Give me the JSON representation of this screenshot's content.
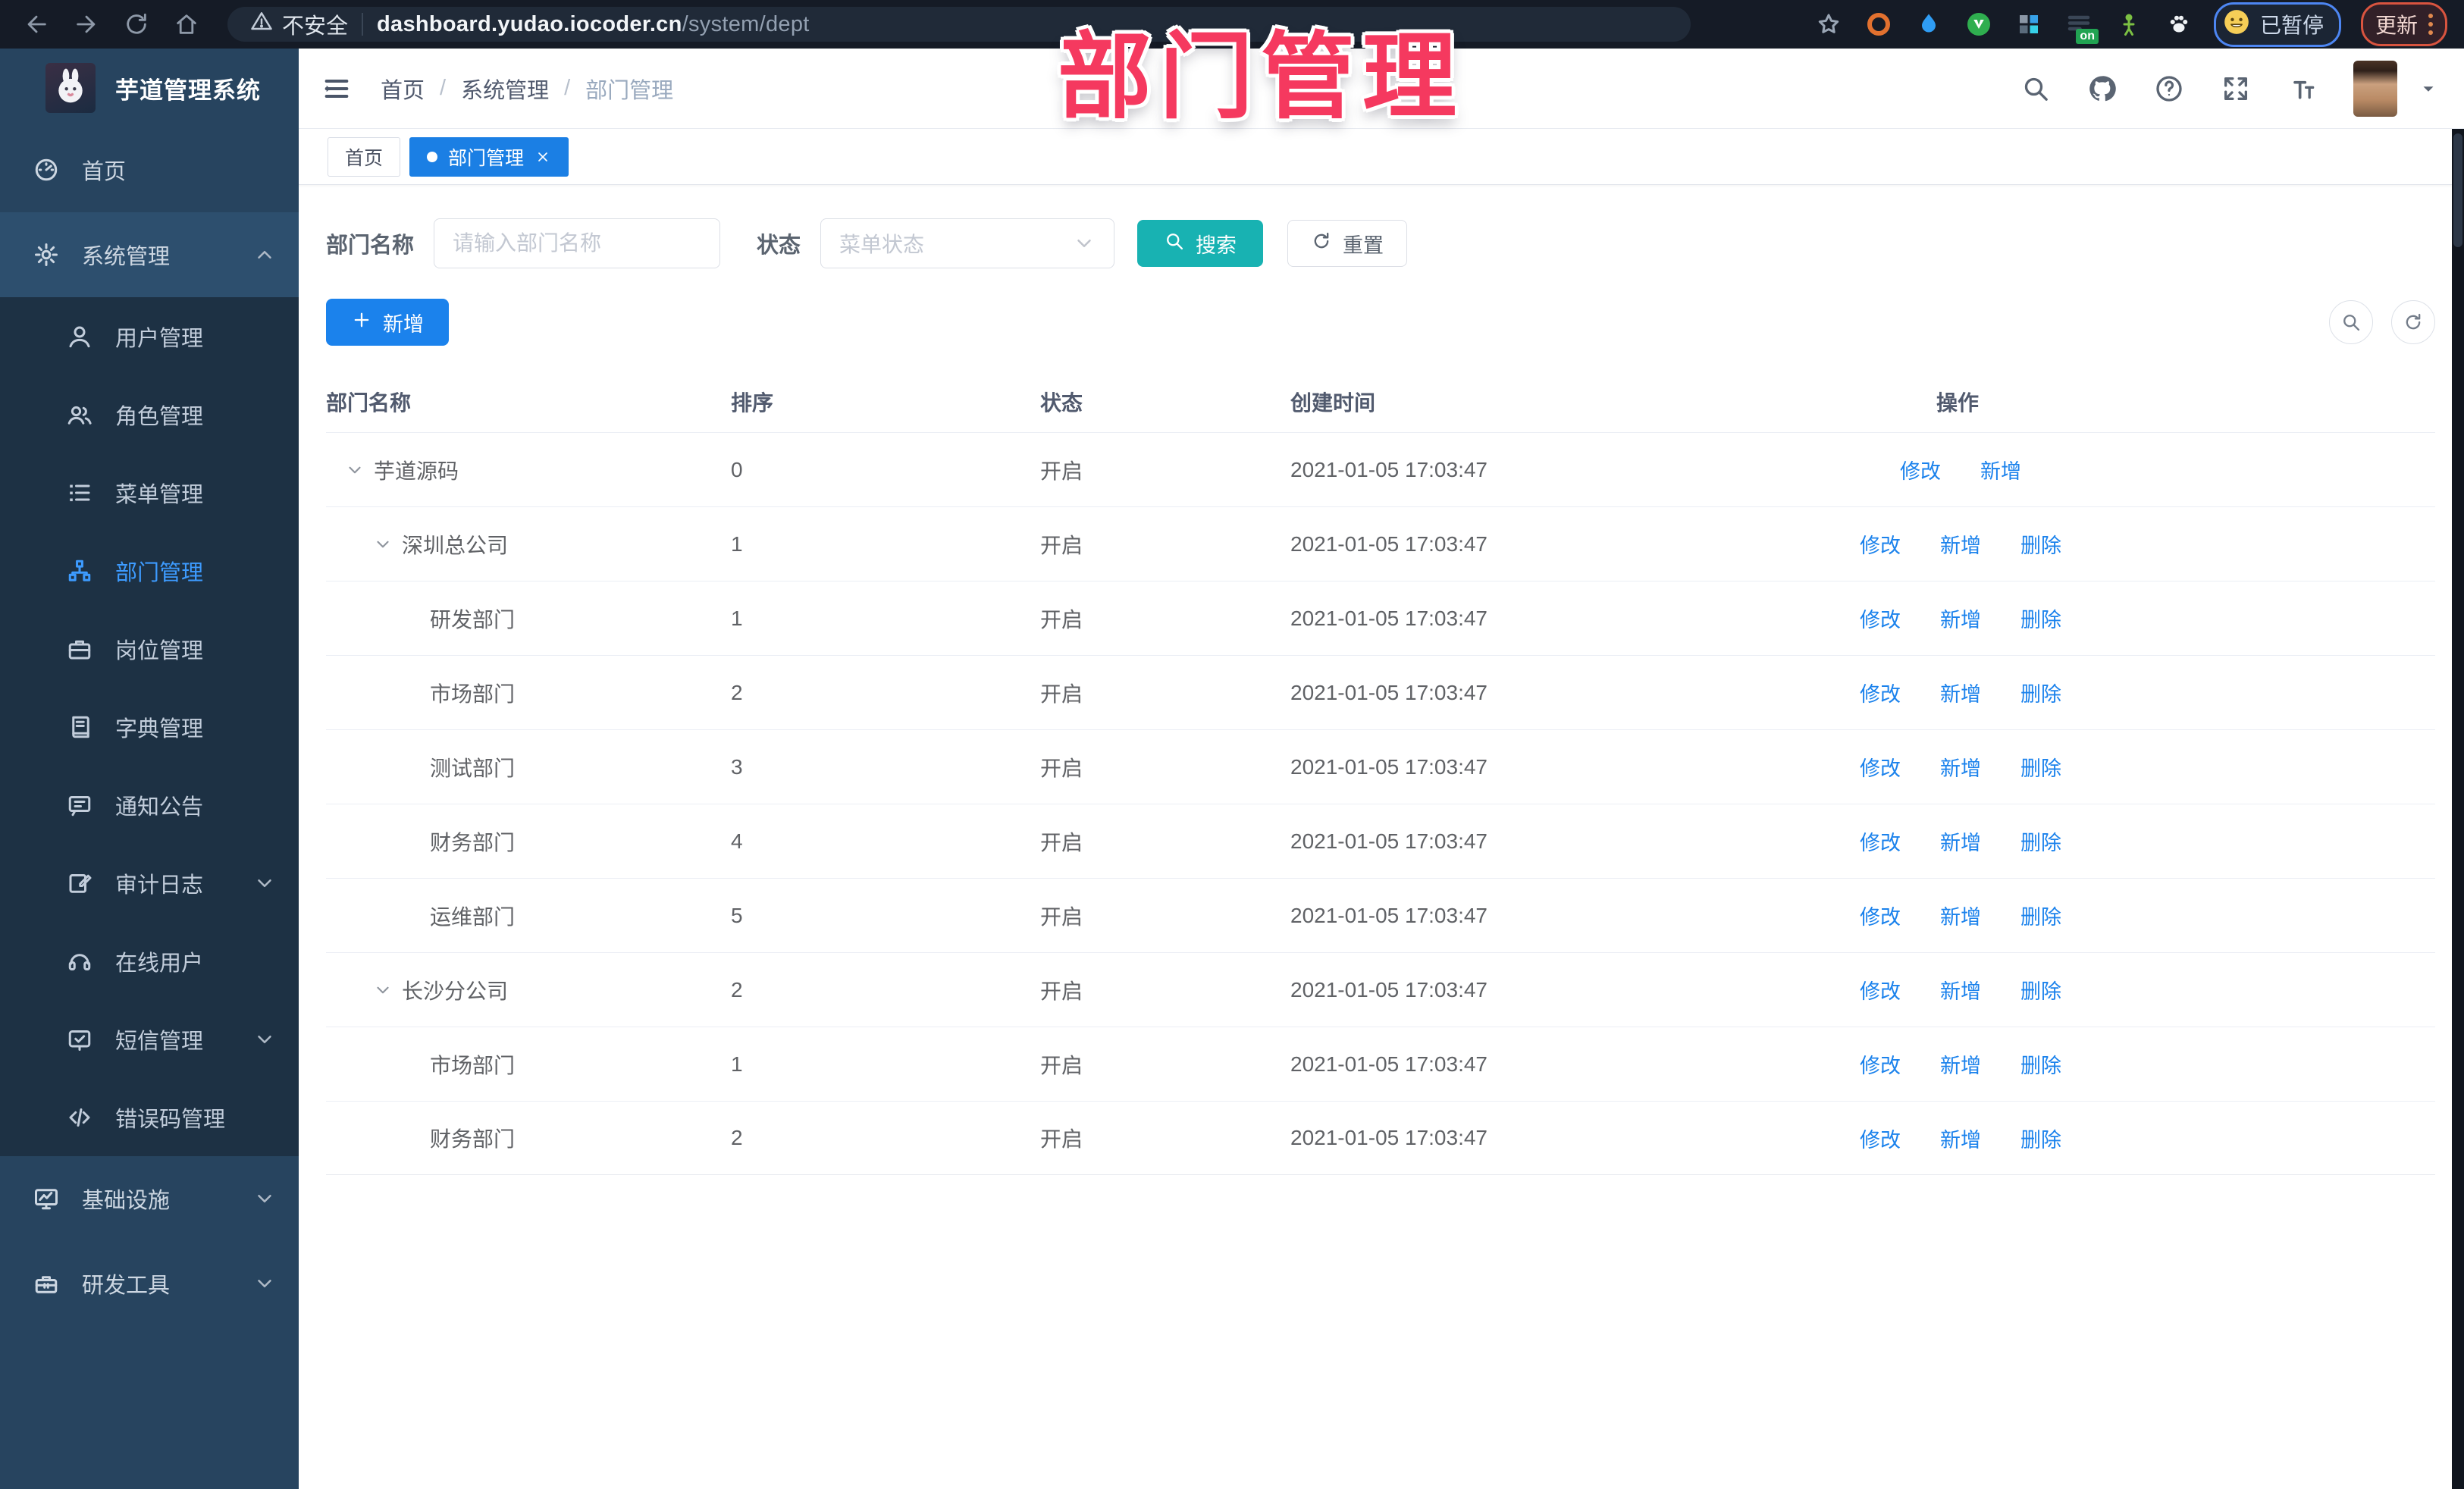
{
  "watermark": {
    "text": "部门管理",
    "color": "#f5395f"
  },
  "browser": {
    "security_label": "不安全",
    "url_host": "dashboard.yudao.iocoder.cn",
    "url_path": "/system/dept",
    "profile_status": "已暂停",
    "update_label": "更新",
    "nav_icons": [
      "back-icon",
      "forward-icon",
      "reload-icon",
      "home-icon"
    ],
    "extension_icons": [
      "star-icon",
      "orange-ring-icon",
      "blue-drop-icon",
      "vue-devtools-icon",
      "grid-extension-icon",
      "adblock-on-icon",
      "green-figure-icon",
      "paw-icon"
    ]
  },
  "sidebar": {
    "logo_title": "芋道管理系统",
    "items": [
      {
        "label": "首页",
        "icon": "dashboard-icon",
        "type": "root"
      },
      {
        "label": "系统管理",
        "icon": "gear-icon",
        "type": "root",
        "active_parent": true,
        "chevron": "up"
      },
      {
        "label": "用户管理",
        "icon": "user-icon",
        "type": "sub"
      },
      {
        "label": "角色管理",
        "icon": "users-icon",
        "type": "sub"
      },
      {
        "label": "菜单管理",
        "icon": "menu-list-icon",
        "type": "sub"
      },
      {
        "label": "部门管理",
        "icon": "org-tree-icon",
        "type": "sub",
        "active": true
      },
      {
        "label": "岗位管理",
        "icon": "briefcase-icon",
        "type": "sub"
      },
      {
        "label": "字典管理",
        "icon": "dictionary-icon",
        "type": "sub"
      },
      {
        "label": "通知公告",
        "icon": "announcement-icon",
        "type": "sub"
      },
      {
        "label": "审计日志",
        "icon": "audit-log-icon",
        "type": "sub",
        "chevron": "down"
      },
      {
        "label": "在线用户",
        "icon": "headset-icon",
        "type": "sub"
      },
      {
        "label": "短信管理",
        "icon": "sms-icon",
        "type": "sub",
        "chevron": "down"
      },
      {
        "label": "错误码管理",
        "icon": "code-icon",
        "type": "sub"
      },
      {
        "label": "基础设施",
        "icon": "monitor-icon",
        "type": "root",
        "chevron": "down"
      },
      {
        "label": "研发工具",
        "icon": "toolbox-icon",
        "type": "root",
        "chevron": "down"
      }
    ]
  },
  "header": {
    "breadcrumb": [
      "首页",
      "系统管理",
      "部门管理"
    ],
    "action_icons": [
      "search-icon",
      "github-icon",
      "help-icon",
      "fullscreen-icon",
      "font-size-icon"
    ]
  },
  "tabs": [
    {
      "label": "首页",
      "active": false
    },
    {
      "label": "部门管理",
      "active": true,
      "closable": true
    }
  ],
  "filters": {
    "name_label": "部门名称",
    "name_placeholder": "请输入部门名称",
    "status_label": "状态",
    "status_placeholder": "菜单状态",
    "search_label": "搜索",
    "reset_label": "重置"
  },
  "toolbar": {
    "add_label": "新增"
  },
  "table": {
    "columns": [
      "部门名称",
      "排序",
      "状态",
      "创建时间",
      "操作"
    ],
    "action_labels": {
      "edit": "修改",
      "add": "新增",
      "delete": "删除"
    },
    "rows": [
      {
        "name": "芋道源码",
        "level": 0,
        "expandable": true,
        "sort": "0",
        "status": "开启",
        "created": "2021-01-05 17:03:47",
        "can_delete": false
      },
      {
        "name": "深圳总公司",
        "level": 1,
        "expandable": true,
        "sort": "1",
        "status": "开启",
        "created": "2021-01-05 17:03:47",
        "can_delete": true
      },
      {
        "name": "研发部门",
        "level": 2,
        "expandable": false,
        "sort": "1",
        "status": "开启",
        "created": "2021-01-05 17:03:47",
        "can_delete": true
      },
      {
        "name": "市场部门",
        "level": 2,
        "expandable": false,
        "sort": "2",
        "status": "开启",
        "created": "2021-01-05 17:03:47",
        "can_delete": true
      },
      {
        "name": "测试部门",
        "level": 2,
        "expandable": false,
        "sort": "3",
        "status": "开启",
        "created": "2021-01-05 17:03:47",
        "can_delete": true
      },
      {
        "name": "财务部门",
        "level": 2,
        "expandable": false,
        "sort": "4",
        "status": "开启",
        "created": "2021-01-05 17:03:47",
        "can_delete": true
      },
      {
        "name": "运维部门",
        "level": 2,
        "expandable": false,
        "sort": "5",
        "status": "开启",
        "created": "2021-01-05 17:03:47",
        "can_delete": true
      },
      {
        "name": "长沙分公司",
        "level": 1,
        "expandable": true,
        "sort": "2",
        "status": "开启",
        "created": "2021-01-05 17:03:47",
        "can_delete": true
      },
      {
        "name": "市场部门",
        "level": 2,
        "expandable": false,
        "sort": "1",
        "status": "开启",
        "created": "2021-01-05 17:03:47",
        "can_delete": true
      },
      {
        "name": "财务部门",
        "level": 2,
        "expandable": false,
        "sort": "2",
        "status": "开启",
        "created": "2021-01-05 17:03:47",
        "can_delete": true
      }
    ]
  },
  "colors": {
    "primary_blue": "#1b82ec",
    "tab_active_blue": "#1b7fe4",
    "search_teal": "#18b2b2",
    "watermark_pink": "#f5395f",
    "sidebar_bg": "#27445f",
    "sidebar_submenu_bg": "#1d3144",
    "active_link": "#3d9bff"
  }
}
